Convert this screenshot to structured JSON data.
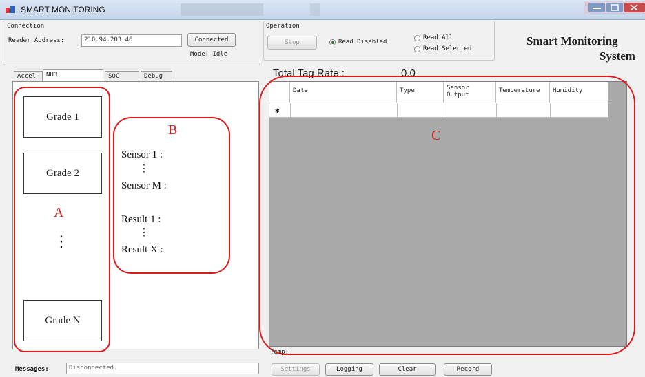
{
  "window": {
    "title": "SMART MONITORING"
  },
  "connection": {
    "group_label": "Connection",
    "reader_label": "Reader Address:",
    "reader_value": "210.94.203.46",
    "connect_button": "Connected",
    "mode": "Mode: Idle"
  },
  "operation": {
    "group_label": "Operation",
    "stop_button": "Stop",
    "radio_read_disabled": "Read Disabled",
    "radio_read_all": "Read All",
    "radio_read_selected": "Read Selected",
    "selected": "Read Disabled"
  },
  "app_title": {
    "line1": "Smart Monitoring",
    "line2": "System"
  },
  "tabs": [
    {
      "label": "Accel"
    },
    {
      "label": "NH3"
    },
    {
      "label": "SOC"
    },
    {
      "label": "Debug"
    }
  ],
  "left_panel": {
    "grades": [
      "Grade 1",
      "Grade 2",
      "Grade N"
    ],
    "vdots": "⋮",
    "sensors": [
      "Sensor 1 :",
      "Sensor M :"
    ],
    "results": [
      "Result  1 :",
      "Result  X :"
    ]
  },
  "rate": {
    "label": "Total Tag Rate :",
    "value": "0.0"
  },
  "grid": {
    "columns": [
      "Date",
      "Type",
      "Sensor Output",
      "Temperature",
      "Humidity"
    ],
    "new_row_marker": "✱"
  },
  "annotations": {
    "a": "A",
    "b": "B",
    "c": "C"
  },
  "temp_label": "Temp:",
  "messages": {
    "label": "Messages:",
    "value": "Disconnected."
  },
  "bottom_buttons": {
    "settings": "Settings",
    "logging": "Logging",
    "clear": "Clear",
    "record": "Record"
  },
  "colors": {
    "annotation_red": "#e01818",
    "grid_background": "#a9a9a9"
  }
}
